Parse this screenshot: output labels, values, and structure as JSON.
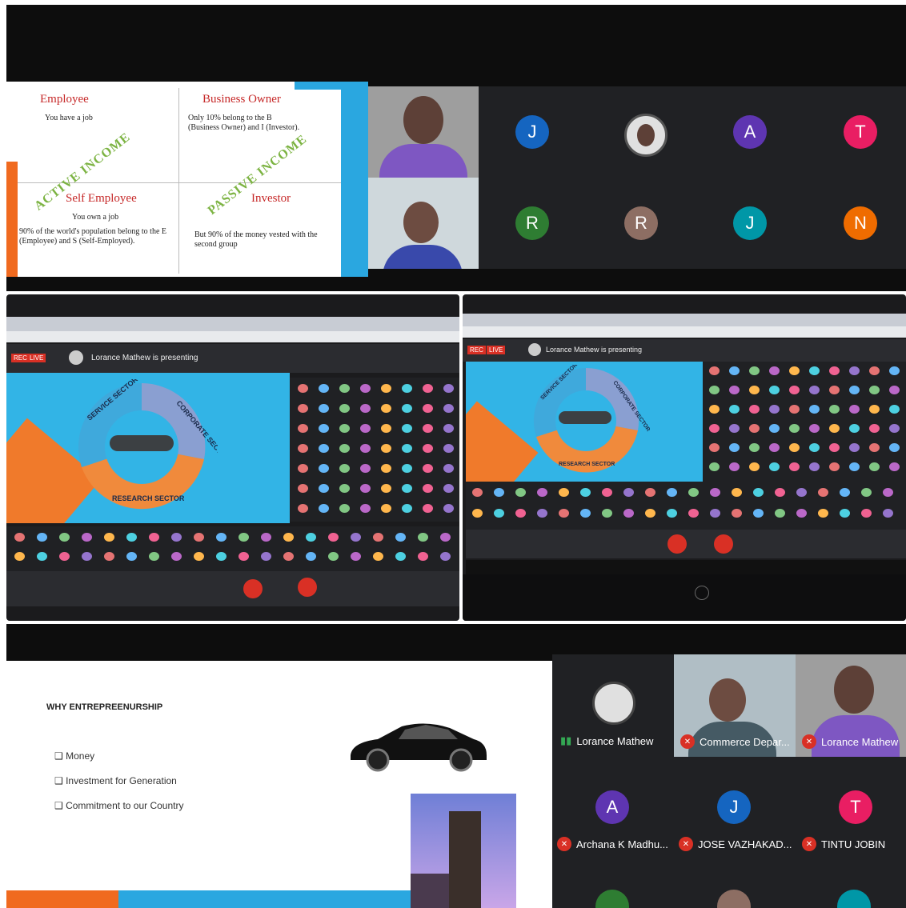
{
  "panel1": {
    "slide": {
      "q1_title": "Employee",
      "q1_text": "You have a job",
      "q2_title": "Business Owner",
      "q2_text": "Only 10% belong to the B (Business Owner) and I (Investor).",
      "q3_title": "Self Employee",
      "q3_sub": "You own a job",
      "q3_text": "90% of the world's population belong to the E (Employee) and S (Self-Employed).",
      "q4_title": "Investor",
      "q4_text": "But 90% of the money vested with the second group",
      "stamp_active": "ACTIVE INCOME",
      "stamp_passive": "PASSIVE INCOME"
    },
    "avatars": [
      {
        "letter": "J",
        "color": "#1565c0"
      },
      {
        "letter": "",
        "color": "#e0e0e0"
      },
      {
        "letter": "A",
        "color": "#5e35b1"
      },
      {
        "letter": "T",
        "color": "#e91e63"
      },
      {
        "letter": "R",
        "color": "#2e7d32"
      },
      {
        "letter": "R",
        "color": "#8d6e63"
      },
      {
        "letter": "J",
        "color": "#0097a7"
      },
      {
        "letter": "N",
        "color": "#ef6c00"
      }
    ]
  },
  "panel2": {
    "presenting_text": "Lorance Mathew is presenting",
    "live_label": "LIVE",
    "rec_label": "REC",
    "donut_labels": {
      "service": "SERVICE SECTOR",
      "corporate": "CORPORATE SECTOR",
      "research": "RESEARCH SECTOR"
    }
  },
  "panel3": {
    "presenting_text": "Lorance Mathew is presenting",
    "live_label": "LIVE",
    "rec_label": "REC",
    "donut_labels": {
      "service": "SERVICE SECTOR",
      "corporate": "CORPORATE SECTOR",
      "research": "RESEARCH SECTOR"
    }
  },
  "panel4": {
    "slide_title": "WHY ENTREPREENURSHIP",
    "bullets": [
      "Money",
      "Investment for Generation",
      "Commitment to our Country"
    ],
    "participants": [
      {
        "name": "Lorance Mathew",
        "type": "photo"
      },
      {
        "name": "Commerce Depar...",
        "type": "video"
      },
      {
        "name": "Lorance Mathew",
        "type": "video"
      },
      {
        "name": "Archana K Madhu...",
        "letter": "A",
        "color": "#5e35b1"
      },
      {
        "name": "JOSE VAZHAKAD...",
        "letter": "J",
        "color": "#1565c0"
      },
      {
        "name": "TINTU JOBIN",
        "letter": "T",
        "color": "#e91e63"
      }
    ]
  }
}
